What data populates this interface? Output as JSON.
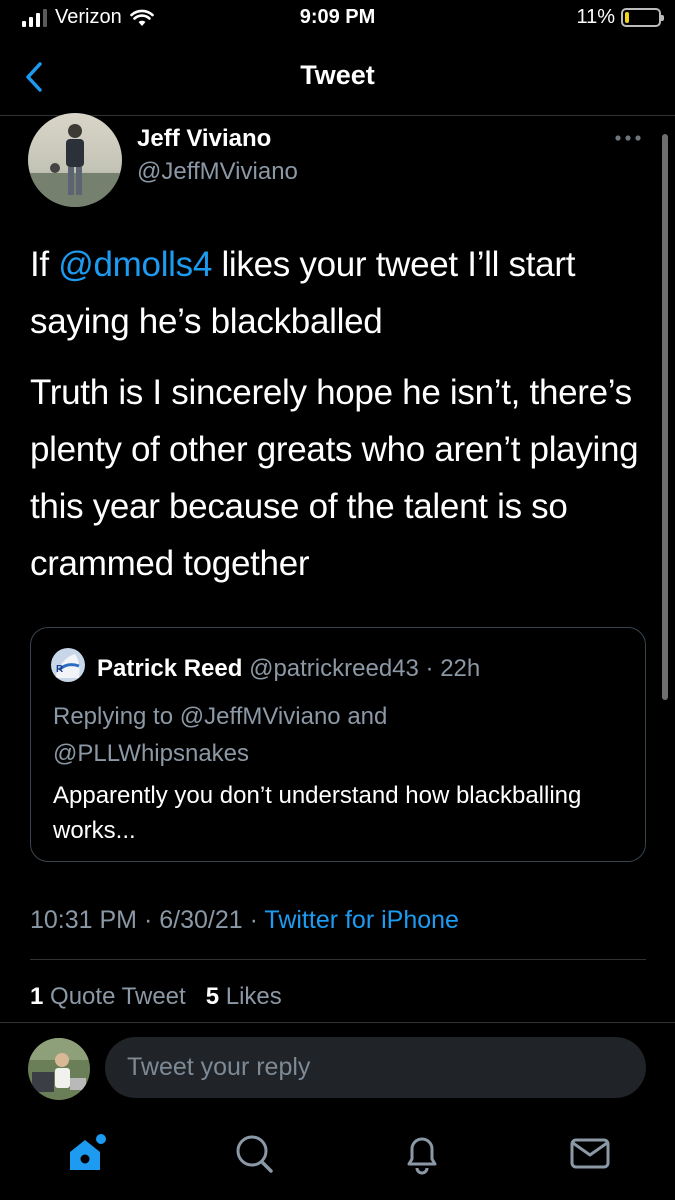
{
  "status_bar": {
    "carrier": "Verizon",
    "time": "9:09 PM",
    "battery_percent": "11%",
    "battery_level": 0.11
  },
  "nav": {
    "title": "Tweet"
  },
  "tweet": {
    "author_name": "Jeff Viviano",
    "author_handle": "@JeffMViviano",
    "line1_prefix": "If ",
    "mention": "@dmolls4",
    "line1_suffix": " likes your tweet I’ll start saying he’s blackballed",
    "paragraph2": "Truth is I sincerely hope he isn’t, there’s plenty of other greats who aren’t playing this year because of the talent is so crammed together"
  },
  "quote": {
    "name": "Patrick Reed",
    "handle": "@patrickreed43",
    "age": "22h",
    "reply_prefix": "Replying to",
    "reply_to_1": "@JeffMViviano",
    "reply_and": "and",
    "reply_to_2": "@PLLWhipsnakes",
    "text": "Apparently you don’t understand how blackballing works..."
  },
  "meta": {
    "time": "10:31 PM",
    "date": "6/30/21",
    "source": "Twitter for iPhone"
  },
  "stats": {
    "quote_count": "1",
    "quote_label": "Quote Tweet",
    "like_count": "5",
    "like_label": "Likes"
  },
  "reply": {
    "placeholder": "Tweet your reply"
  },
  "tabs": [
    "home-icon",
    "search-icon",
    "notifications-icon",
    "messages-icon"
  ],
  "colors": {
    "accent": "#1d9bf0",
    "background": "#000000",
    "muted": "#8b98a5",
    "battery": "#f2d21b"
  }
}
